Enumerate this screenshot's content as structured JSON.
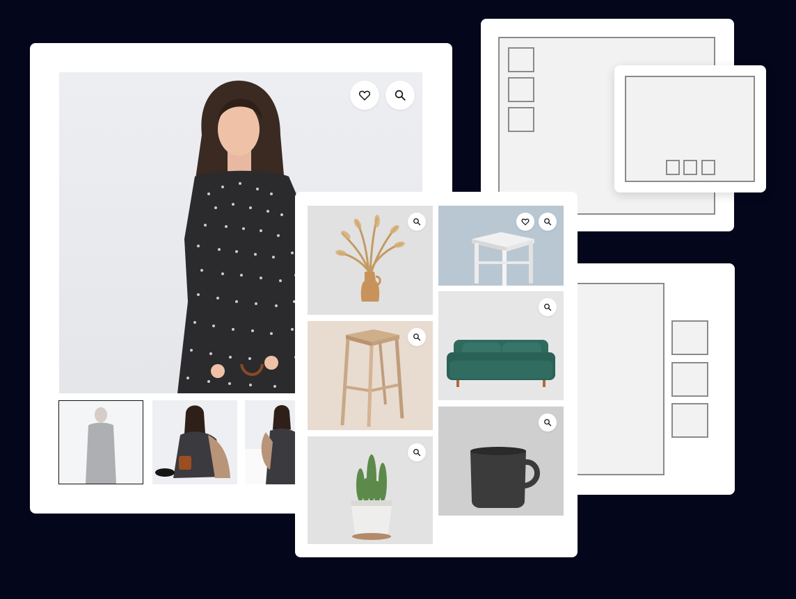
{
  "colors": {
    "page_background": "#04071b",
    "card_background": "#ffffff",
    "wireframe_stroke": "#8a8a8a",
    "wireframe_fill": "#f2f2f2"
  },
  "product_gallery": {
    "main_image": "woman-in-black-polka-dot-dress-photo",
    "actions": [
      {
        "icon": "heart-icon"
      },
      {
        "icon": "search-icon"
      }
    ],
    "thumbnails": [
      {
        "image": "woman-standing-full-length-photo",
        "selected": true
      },
      {
        "image": "woman-sitting-with-brown-bag-photo",
        "selected": false
      },
      {
        "image": "woman-sitting-on-cube-photo",
        "selected": false
      }
    ]
  },
  "product_grid": {
    "tiles": [
      {
        "image": "dried-pampas-grass-vase-photo",
        "icons": [
          "search-icon"
        ]
      },
      {
        "image": "white-wooden-stool-photo",
        "icons": [
          "heart-icon",
          "search-icon"
        ]
      },
      {
        "image": "wooden-bar-stool-photo",
        "icons": [
          "search-icon"
        ]
      },
      {
        "image": "green-velvet-sofa-photo",
        "icons": [
          "search-icon"
        ]
      },
      {
        "image": "cactus-in-white-pot-photo",
        "icons": [
          "search-icon"
        ]
      },
      {
        "image": "dark-ceramic-mug-photo",
        "icons": [
          "search-icon"
        ]
      }
    ]
  },
  "layout_variants": [
    {
      "name": "left-thumbnails-wireframe"
    },
    {
      "name": "popup-gallery-wireframe"
    },
    {
      "name": "right-thumbnails-wireframe"
    }
  ]
}
